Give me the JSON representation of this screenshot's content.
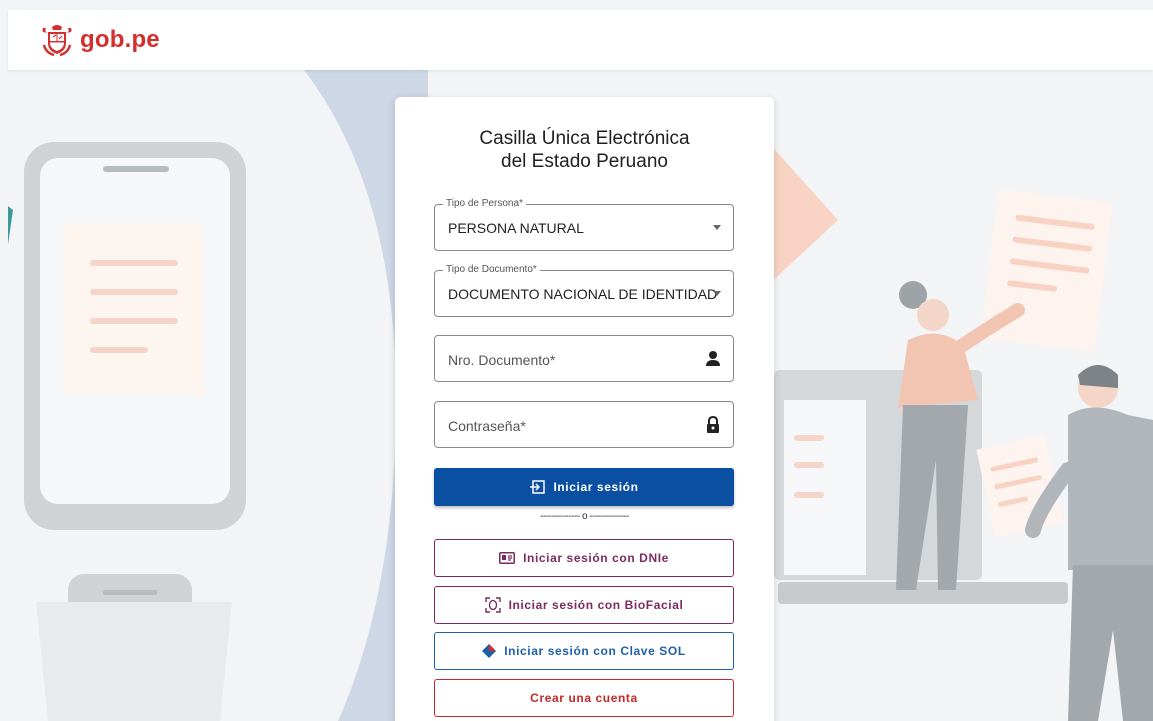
{
  "header": {
    "brand": "gob.pe",
    "logo_icon": "peru-coat-of-arms-icon"
  },
  "login": {
    "title_line1": "Casilla Única Electrónica",
    "title_line2": "del Estado Peruano",
    "tipo_persona": {
      "label": "Tipo de Persona*",
      "value": "PERSONA NATURAL"
    },
    "tipo_documento": {
      "label": "Tipo de Documento*",
      "value": "DOCUMENTO NACIONAL DE IDENTIDAD"
    },
    "nro_documento": {
      "placeholder": "Nro. Documento*",
      "icon": "person-icon"
    },
    "contrasena": {
      "placeholder": "Contraseña*",
      "icon": "lock-icon"
    },
    "login_button": "Iniciar sesión",
    "separator": "-------------- o --------------",
    "dnie_button": "Iniciar sesión con DNIe",
    "biofacial_button": "Iniciar sesión con BioFacial",
    "clave_sol_button": "Iniciar sesión con Clave SOL",
    "create_account_button": "Crear una cuenta"
  },
  "colors": {
    "brand_red": "#d32f2f",
    "primary_blue": "#0b4fa3",
    "dnie_purple": "#7b2a5f",
    "clave_sol_blue": "#1f5fa8",
    "create_red": "#c62828"
  }
}
